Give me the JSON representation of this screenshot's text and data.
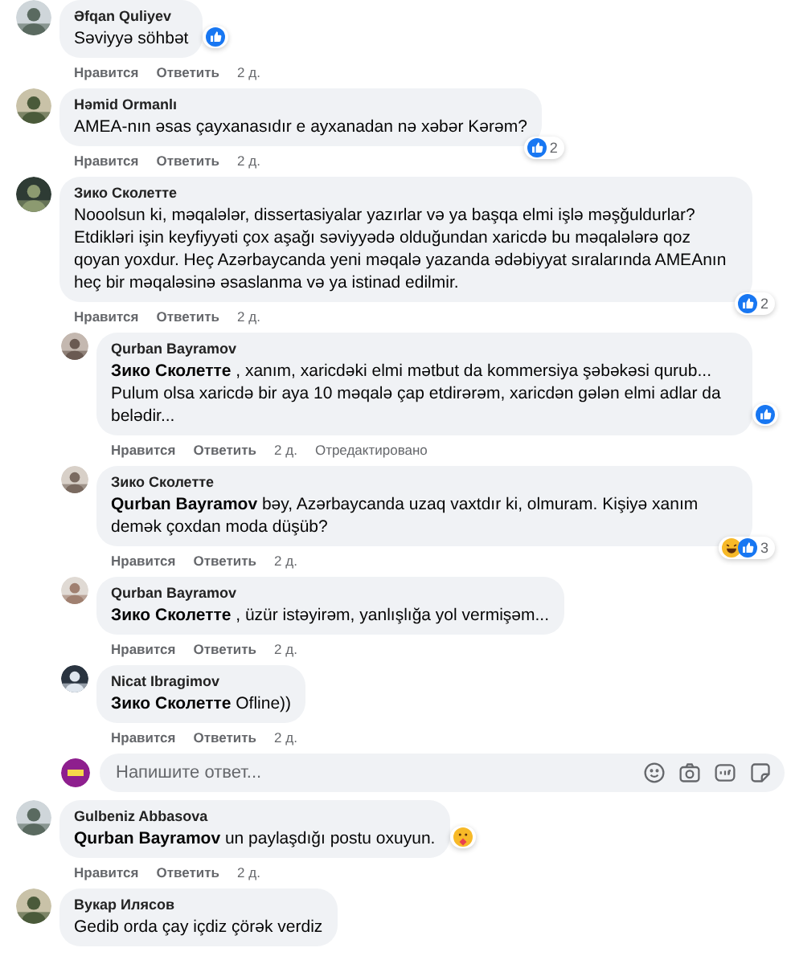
{
  "comments": [
    {
      "author": "Əfqan Quliyev",
      "text": "Səviyyə söhbət",
      "reactions": {
        "items": [
          {
            "kind": "like"
          }
        ]
      },
      "actions": {
        "like": "Нравится",
        "reply": "Ответить",
        "time": "2 д."
      }
    },
    {
      "author": "Həmid Ormanlı",
      "text": "AMEA-nın əsas çayxanasıdır e ayxanadan nə xəbər Kərəm?",
      "reactions": {
        "items": [
          {
            "kind": "like"
          }
        ],
        "count": "2"
      },
      "actions": {
        "like": "Нравится",
        "reply": "Ответить",
        "time": "2 д."
      }
    },
    {
      "author": "Зико Сколетте",
      "text": "Nooolsun ki, məqalələr, dissertasiyalar yazırlar və ya başqa elmi işlə məşğuldurlar? Etdikləri işin keyfiyyəti çox aşağı səviyyədə olduğundan xaricdə bu məqalələrə qoz qoyan yoxdur. Heç Azərbaycanda yeni məqalə yazanda ədəbiyyat sıralarında AMEAnın heç bir məqaləsinə əsaslanma və ya istinad edilmir.",
      "reactions": {
        "items": [
          {
            "kind": "like"
          }
        ],
        "count": "2"
      },
      "actions": {
        "like": "Нравится",
        "reply": "Ответить",
        "time": "2 д."
      },
      "children": [
        {
          "author": "Qurban Bayramov",
          "text": "**Зико Сколетте** , xanım, xaricdəki elmi mətbut da kommersiya şəbəkəsi qurub... Pulum olsa xaricdə bir aya 10 məqalə çap etdirərəm, xaricdən gələn elmi adlar da belədir...",
          "reactions": {
            "items": [
              {
                "kind": "like"
              }
            ]
          },
          "actions": {
            "like": "Нравится",
            "reply": "Ответить",
            "time": "2 д.",
            "edited": "Отредактировано"
          }
        },
        {
          "author": "Зико Сколетте",
          "text": "**Qurban Bayramov** bəy, Azərbaycanda uzaq vaxtdır ki, olmuram. Kişiyə xanım demək çoxdan moda düşüb?",
          "reactions": {
            "items": [
              {
                "kind": "haha"
              },
              {
                "kind": "like"
              }
            ],
            "count": "3"
          },
          "actions": {
            "like": "Нравится",
            "reply": "Ответить",
            "time": "2 д."
          }
        },
        {
          "author": "Qurban Bayramov",
          "text": "**Зико Сколетте** , üzür istəyirəm, yanlışlığa yol vermişəm...",
          "actions": {
            "like": "Нравится",
            "reply": "Ответить",
            "time": "2 д."
          }
        },
        {
          "author": "Nicat Ibragimov",
          "text": "**Зико Сколетте** Ofline))",
          "actions": {
            "like": "Нравится",
            "reply": "Ответить",
            "time": "2 д."
          }
        }
      ],
      "reply_box": {
        "placeholder": "Напишите ответ..."
      }
    },
    {
      "author": "Gulbeniz Abbasova",
      "text": "**Qurban Bayramov** un paylaşdığı postu oxuyun.",
      "reactions": {
        "items": [
          {
            "kind": "care"
          }
        ]
      },
      "actions": {
        "like": "Нравится",
        "reply": "Ответить",
        "time": "2 д."
      }
    },
    {
      "author": "Вукар Илясов",
      "text": "Gedib orda çay içdiz çörək verdiz"
    }
  ]
}
